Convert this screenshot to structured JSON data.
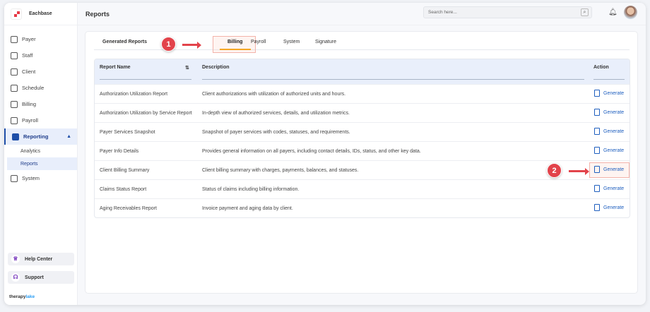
{
  "brand": {
    "name": "Eachbase",
    "footer_a": "therapy",
    "footer_b": "lake"
  },
  "sidebar": {
    "items": [
      {
        "label": "Payer",
        "icon": "shield-icon"
      },
      {
        "label": "Staff",
        "icon": "team-icon"
      },
      {
        "label": "Client",
        "icon": "user-icon"
      },
      {
        "label": "Schedule",
        "icon": "calendar-icon"
      },
      {
        "label": "Billing",
        "icon": "receipt-icon"
      },
      {
        "label": "Payroll",
        "icon": "money-icon"
      },
      {
        "label": "Reporting",
        "icon": "report-icon",
        "active": true
      },
      {
        "label": "System",
        "icon": "gear-icon"
      }
    ],
    "sub": [
      {
        "label": "Analytics"
      },
      {
        "label": "Reports",
        "selected": true
      }
    ],
    "help": "Help Center",
    "support": "Support"
  },
  "header": {
    "title": "Reports",
    "search_placeholder": "Search here..."
  },
  "tabs": [
    {
      "label": "Generated Reports"
    },
    {
      "label": "Billing",
      "active": true
    },
    {
      "label": "Payroll"
    },
    {
      "label": "System"
    },
    {
      "label": "Signature"
    }
  ],
  "annotations": [
    "1",
    "2"
  ],
  "table": {
    "headers": [
      "Report Name",
      "Description",
      "Action"
    ],
    "sort_icon": "⇅",
    "rows": [
      {
        "name": "Authorization Utilization Report",
        "desc": "Client authorizations with utilization of authorized units and hours.",
        "action": "Generate"
      },
      {
        "name": "Authorization Utilization by Service Report",
        "desc": "In-depth view of authorized services, details, and utilization metrics.",
        "action": "Generate"
      },
      {
        "name": "Payer Services Snapshot",
        "desc": "Snapshot of payer services with codes, statuses, and requirements.",
        "action": "Generate"
      },
      {
        "name": "Payer Info Details",
        "desc": "Provides general information on all payers, including contact details, IDs, status, and other key data.",
        "action": "Generate"
      },
      {
        "name": "Client Billing Summary",
        "desc": "Client billing summary with charges, payments, balances, and statuses.",
        "action": "Generate"
      },
      {
        "name": "Claims Status Report",
        "desc": "Status of claims including billing information.",
        "action": "Generate"
      },
      {
        "name": "Aging Receivables Report",
        "desc": "Invoice payment and aging data by client.",
        "action": "Generate"
      }
    ]
  },
  "colors": {
    "accent": "#1f4fa8",
    "annotation": "#e2434b",
    "tab_underline": "#f5a623"
  }
}
